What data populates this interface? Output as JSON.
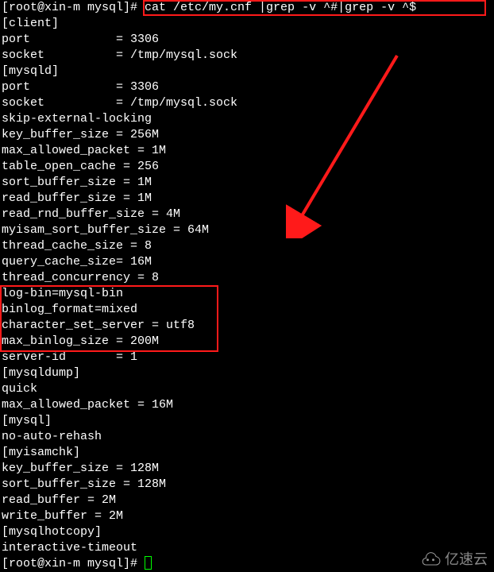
{
  "terminal": {
    "prompt_user_host": "[root@xin-m mysql]# ",
    "command": "cat /etc/my.cnf |grep -v ^#|grep -v ^$",
    "lines": [
      "[client]",
      "port            = 3306",
      "socket          = /tmp/mysql.sock",
      "[mysqld]",
      "port            = 3306",
      "socket          = /tmp/mysql.sock",
      "skip-external-locking",
      "key_buffer_size = 256M",
      "max_allowed_packet = 1M",
      "table_open_cache = 256",
      "sort_buffer_size = 1M",
      "read_buffer_size = 1M",
      "read_rnd_buffer_size = 4M",
      "myisam_sort_buffer_size = 64M",
      "thread_cache_size = 8",
      "query_cache_size= 16M",
      "thread_concurrency = 8",
      "log-bin=mysql-bin",
      "binlog_format=mixed",
      "character_set_server = utf8",
      "max_binlog_size = 200M",
      "server-id       = 1",
      "[mysqldump]",
      "quick",
      "max_allowed_packet = 16M",
      "[mysql]",
      "no-auto-rehash",
      "[myisamchk]",
      "key_buffer_size = 128M",
      "sort_buffer_size = 128M",
      "read_buffer = 2M",
      "write_buffer = 2M",
      "[mysqlhotcopy]",
      "interactive-timeout"
    ],
    "prompt_end": "[root@xin-m mysql]# "
  },
  "watermark": {
    "text": "亿速云"
  },
  "annotations": {
    "top_box": "command-highlight",
    "mid_box": "binlog-settings-highlight",
    "arrow": "attention-arrow"
  }
}
